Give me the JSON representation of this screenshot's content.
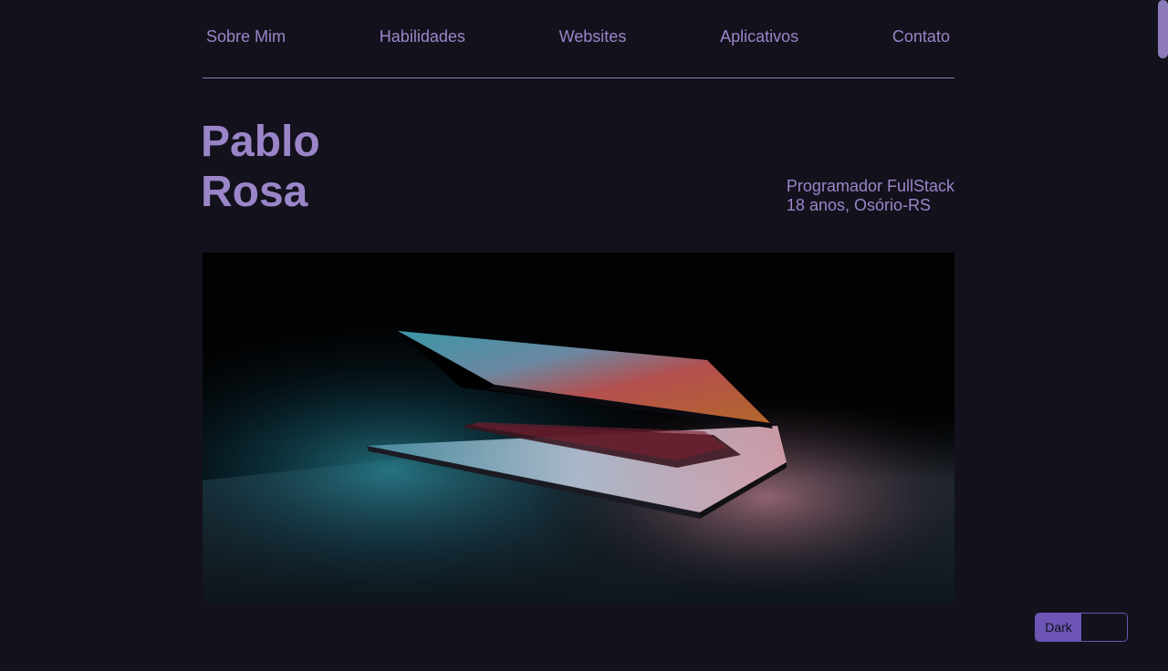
{
  "nav": {
    "items": [
      {
        "label": "Sobre Mim"
      },
      {
        "label": "Habilidades"
      },
      {
        "label": "Websites"
      },
      {
        "label": "Aplicativos"
      },
      {
        "label": "Contato"
      }
    ]
  },
  "hero": {
    "first_name": "Pablo",
    "last_name": "Rosa",
    "role": "Programador FullStack",
    "details": "18 anos, Osório-RS"
  },
  "theme_toggle": {
    "label": "Dark"
  },
  "colors": {
    "background": "#13111c",
    "accent": "#9b85c9",
    "toggle": "#6d55b6"
  }
}
